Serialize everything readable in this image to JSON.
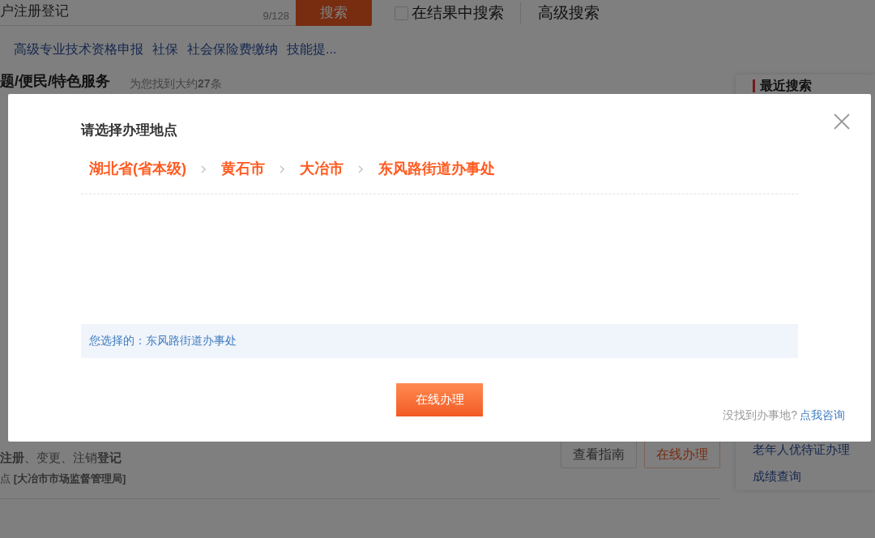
{
  "page": {
    "search": {
      "value": "户注册登记",
      "counter": "9/128",
      "button": "搜索"
    },
    "in_results": {
      "label": "在结果中搜索",
      "checked": false
    },
    "advanced_search": "高级搜索",
    "hot_links": [
      "高级专业技术资格申报",
      "社保",
      "社会保险费缴纳",
      "技能提..."
    ],
    "section": {
      "title": "题/便民/特色服务",
      "count": "为您找到大约**27**条"
    },
    "result": {
      "description": "**注册**、变更、注销**登记**",
      "location": "点 **[大冶市市场监督管理局]**",
      "buttons": [
        {
          "label": "查看指南",
          "kind": "guide"
        },
        {
          "label": "在线办理",
          "kind": "online"
        }
      ]
    },
    "recent": {
      "title": "最近搜索",
      "items": [
        "老年人优待证办理",
        "成绩查询"
      ]
    }
  },
  "dialog": {
    "title": "请选择办理地点",
    "path": [
      "湖北省(省本级)",
      "黄石市",
      "大冶市",
      "东风路街道办事处"
    ],
    "selected_label": "您选择的：",
    "selected_value": "东风路街道办事处",
    "submit": "在线办理",
    "footer_text": "没找到办事地?",
    "footer_link": "点我咨询"
  }
}
